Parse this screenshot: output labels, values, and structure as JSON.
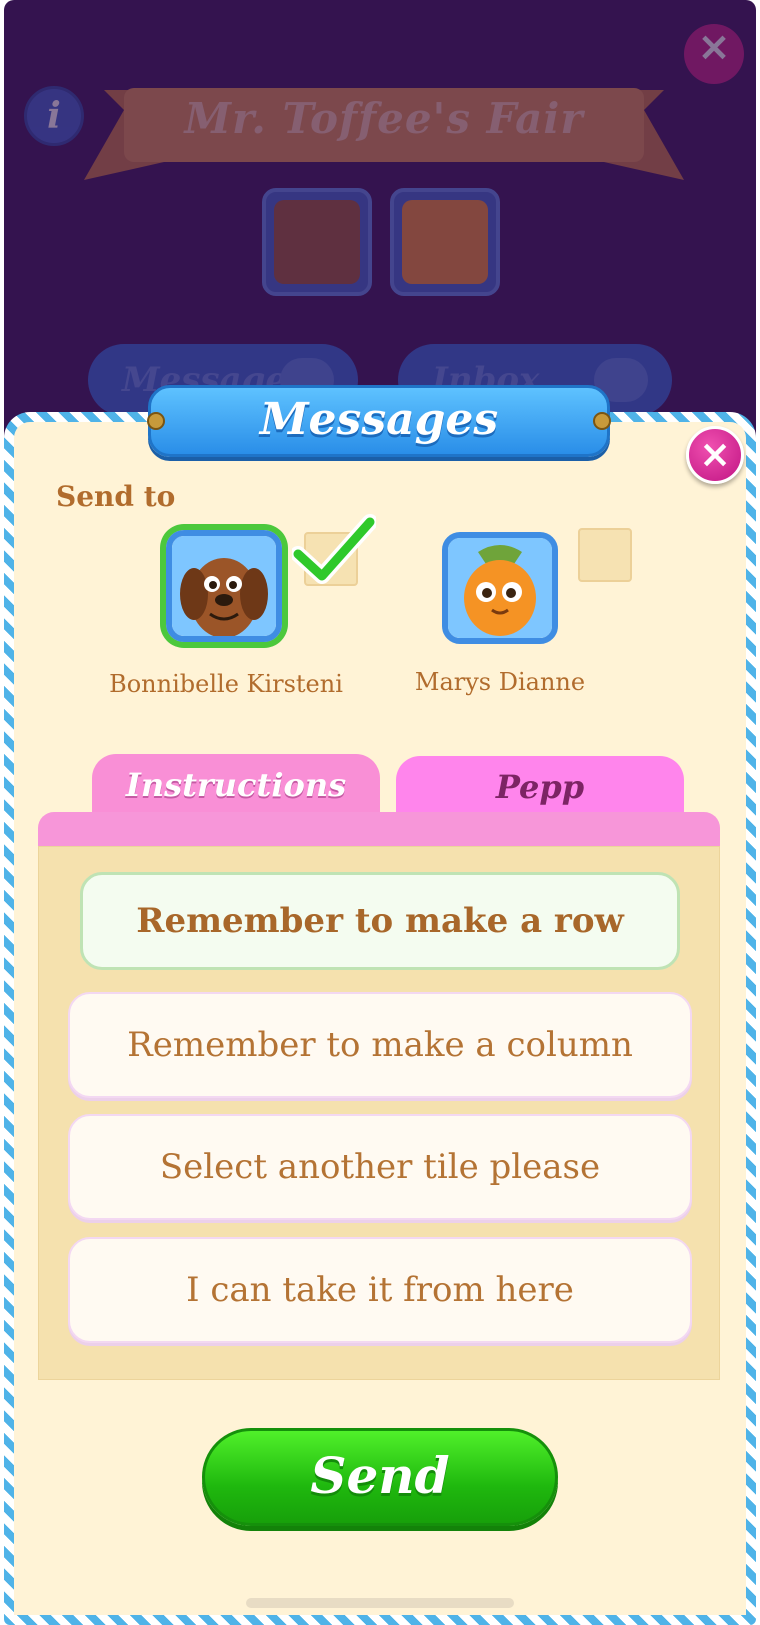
{
  "background": {
    "banner_title": "Mr. Toffee's Fair",
    "info_icon": "i",
    "close_icon": "×",
    "buttons": [
      "Message",
      "Inbox"
    ]
  },
  "dialog": {
    "title": "Messages",
    "close_icon": "×",
    "send_to_label": "Send to",
    "recipients": [
      {
        "name": "Bonnibelle Kirsteni",
        "selected": true,
        "avatar_icon": "brown-dog-avatar"
      },
      {
        "name": "Marys Dianne",
        "selected": false,
        "avatar_icon": "orange-carrot-avatar"
      }
    ],
    "tabs": [
      {
        "label": "Instructions",
        "active": true
      },
      {
        "label": "Pepp",
        "active": false
      }
    ],
    "messages": [
      {
        "text": "Remember to make a row",
        "selected": true
      },
      {
        "text": "Remember to make a column",
        "selected": false
      },
      {
        "text": "Select another tile please",
        "selected": false
      },
      {
        "text": "I can take it from here",
        "selected": false
      }
    ],
    "send_label": "Send"
  },
  "colors": {
    "background": "#34134f",
    "dialog": "#fff3d6",
    "header_blue": "#2a8ee8",
    "tab_pink": "#f98fd6",
    "send_green": "#1fb80e",
    "text_brown": "#b16c2d"
  }
}
